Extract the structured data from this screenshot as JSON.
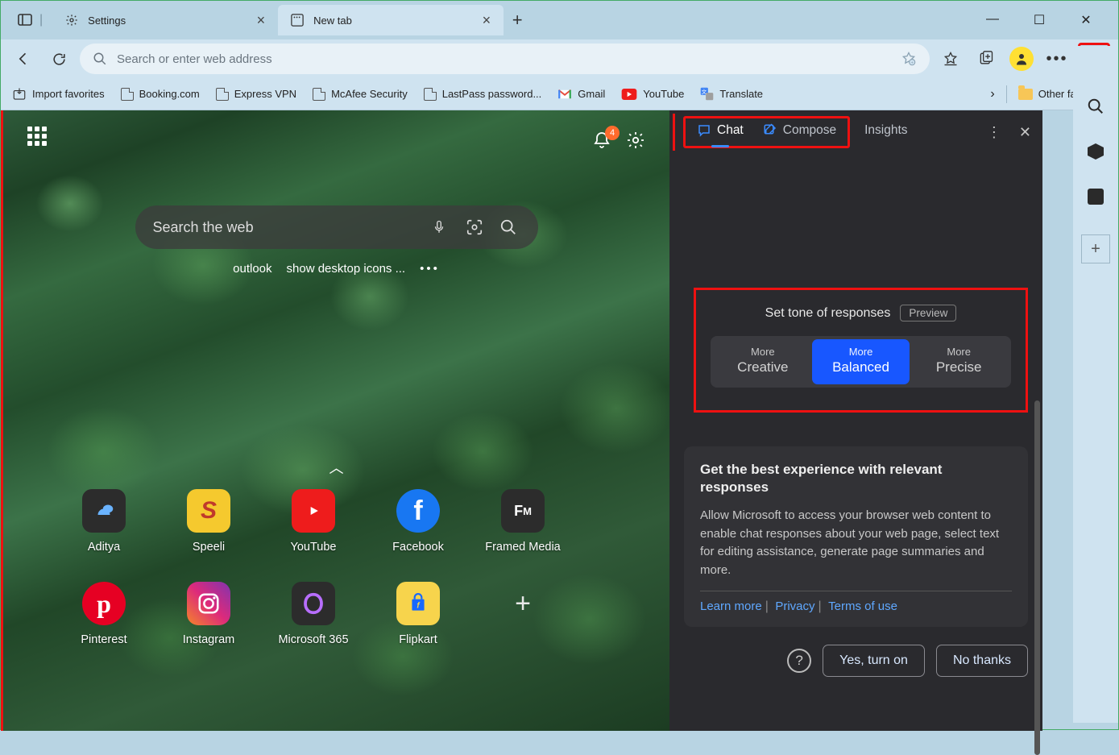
{
  "tabs": [
    {
      "label": "Settings",
      "icon": "gear-icon",
      "active": false
    },
    {
      "label": "New tab",
      "icon": "page-icon",
      "active": true
    }
  ],
  "address": {
    "placeholder": "Search or enter web address"
  },
  "favorites": {
    "import": "Import favorites",
    "items": [
      "Booking.com",
      "Express VPN",
      "McAfee Security",
      "LastPass password...",
      "Gmail",
      "YouTube",
      "Translate"
    ],
    "other": "Other favorites"
  },
  "ntp": {
    "search_placeholder": "Search the web",
    "suggestions": [
      "outlook",
      "show desktop icons ..."
    ],
    "notif_count": "4",
    "tiles": [
      {
        "label": "Aditya",
        "icon": "cloud",
        "bg": "#2c2c2c",
        "fg": "#6ab3ff"
      },
      {
        "label": "Speeli",
        "icon": "S",
        "bg": "#f5c92e",
        "fg": "#c0392b"
      },
      {
        "label": "YouTube",
        "icon": "yt",
        "bg": "#ee1c1c",
        "fg": "#fff"
      },
      {
        "label": "Facebook",
        "icon": "f",
        "bg": "#1877f2",
        "fg": "#fff"
      },
      {
        "label": "Framed Media",
        "icon": "FM",
        "bg": "#2c2c2c",
        "fg": "#ddd"
      },
      {
        "label": "Pinterest",
        "icon": "p",
        "bg": "#e60023",
        "fg": "#fff"
      },
      {
        "label": "Instagram",
        "icon": "ig",
        "bg": "linear-gradient(45deg,#f58529,#dd2a7b,#8134af)",
        "fg": "#fff"
      },
      {
        "label": "Microsoft 365",
        "icon": "m365",
        "bg": "#2c2c2c",
        "fg": "#b86eff"
      },
      {
        "label": "Flipkart",
        "icon": "fk",
        "bg": "#f7d44c",
        "fg": "#1768ff"
      }
    ]
  },
  "panel": {
    "tabs": [
      "Chat",
      "Compose",
      "Insights"
    ],
    "tone_title": "Set tone of responses",
    "preview": "Preview",
    "tones": [
      {
        "l1": "More",
        "l2": "Creative"
      },
      {
        "l1": "More",
        "l2": "Balanced"
      },
      {
        "l1": "More",
        "l2": "Precise"
      }
    ],
    "card_title": "Get the best experience with relevant responses",
    "card_body": "Allow Microsoft to access your browser web content to enable chat responses about your web page, select text for editing assistance, generate page summaries and more.",
    "learn": "Learn more",
    "privacy": "Privacy",
    "terms": "Terms of use",
    "yes": "Yes, turn on",
    "no": "No thanks"
  }
}
